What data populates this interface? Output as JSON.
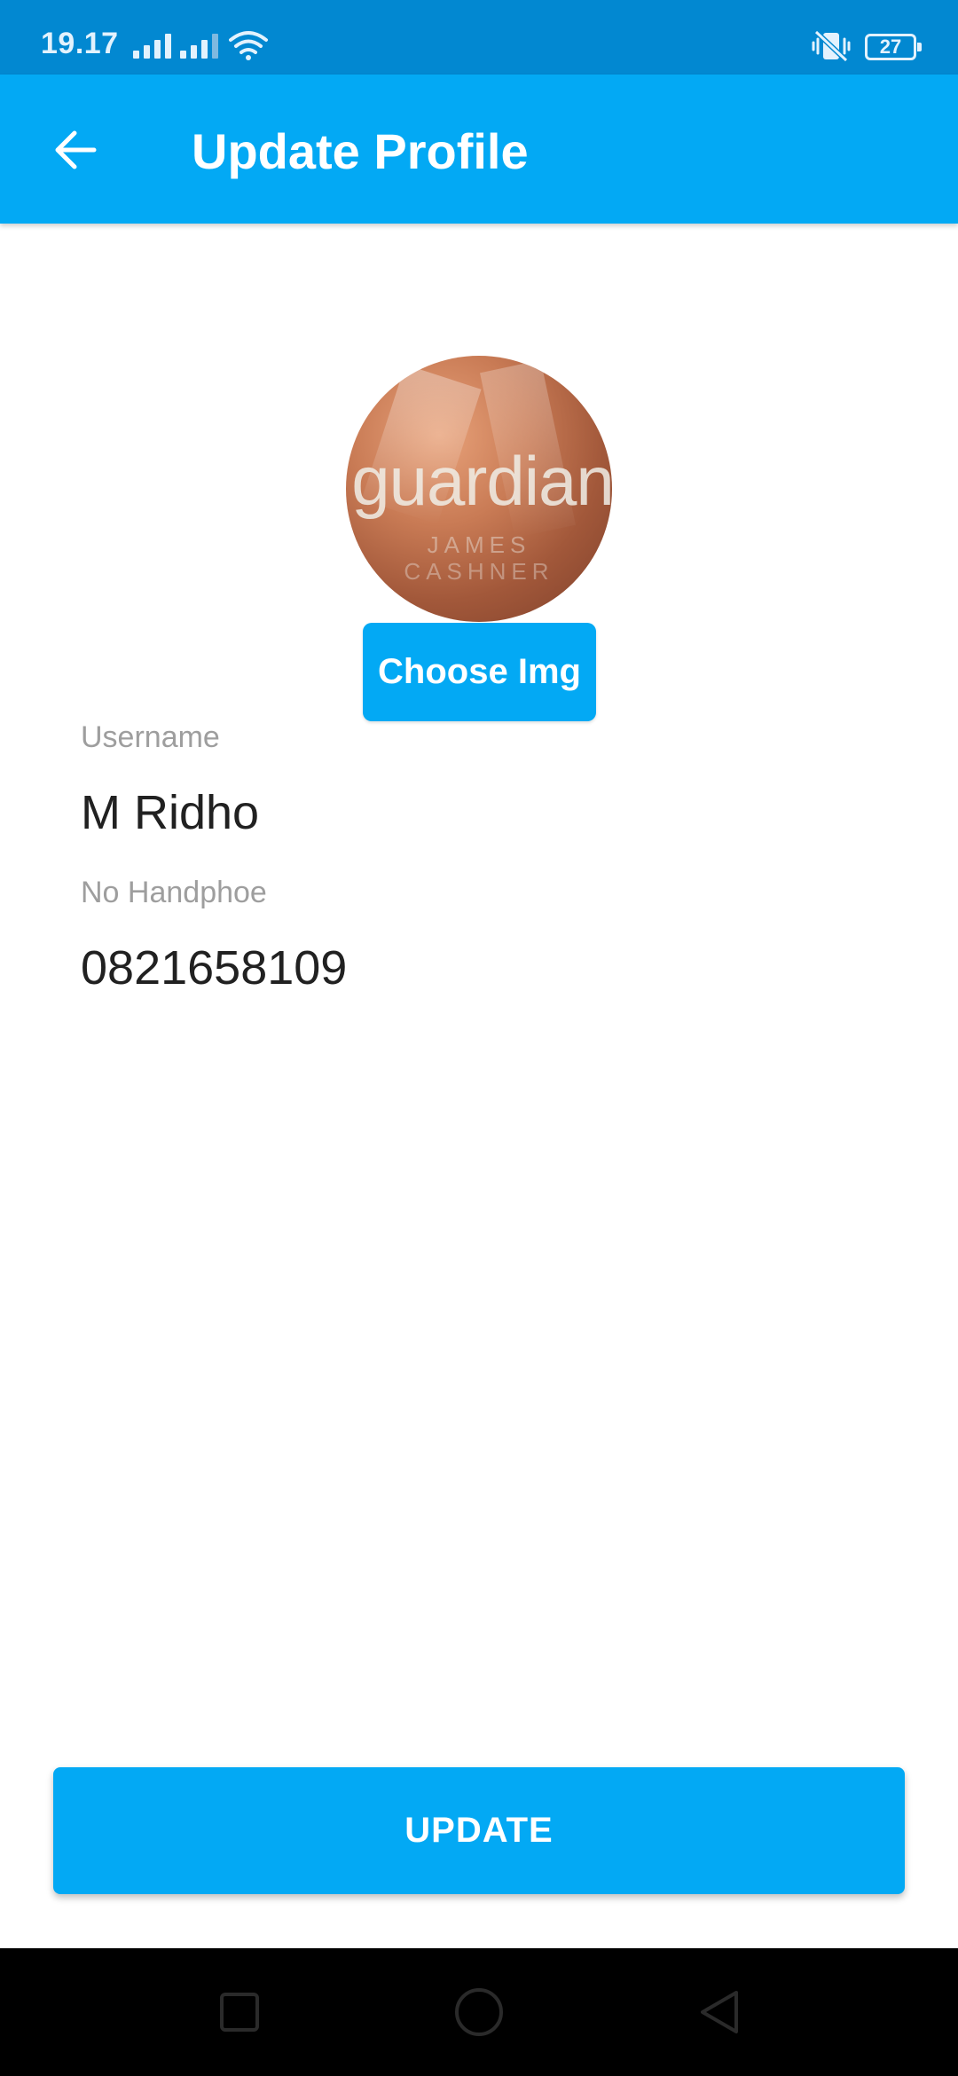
{
  "status_bar": {
    "time": "19.17",
    "battery": "27",
    "icons": [
      "signal-icon",
      "signal-icon",
      "wifi-icon",
      "vibrate-icon",
      "battery-icon"
    ]
  },
  "app_bar": {
    "title": "Update Profile",
    "back_icon": "arrow-left-icon"
  },
  "profile": {
    "avatar_text": "guardian",
    "avatar_sub_1": "JAMES",
    "avatar_sub_2": "CASHNER",
    "choose_button_label": "Choose Img"
  },
  "fields": {
    "username_label": "Username",
    "username_value": "M Ridho",
    "phone_label": "No Handphoe",
    "phone_value": "0821658109"
  },
  "actions": {
    "update_label": "UPDATE"
  },
  "nav_bar": {
    "icons": [
      "recents-icon",
      "home-icon",
      "back-icon"
    ]
  },
  "colors": {
    "status_bar": "#0288d1",
    "app_bar": "#03a9f4",
    "accent": "#03a9f4",
    "nav_bar": "#000000"
  }
}
